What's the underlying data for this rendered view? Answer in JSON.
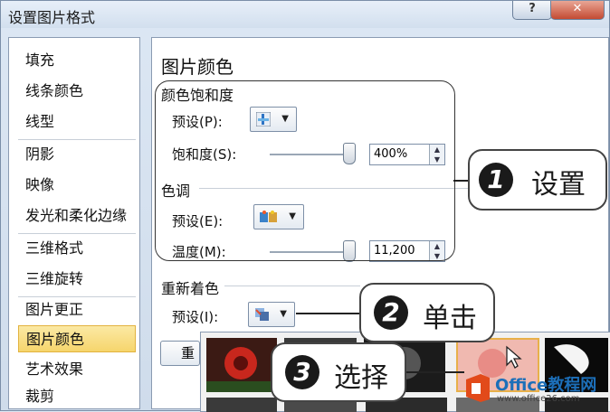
{
  "window": {
    "title": "设置图片格式",
    "help_label": "?",
    "close_label": "✕"
  },
  "nav": {
    "items": [
      {
        "label": "填充"
      },
      {
        "label": "线条颜色"
      },
      {
        "label": "线型"
      },
      {
        "label": "阴影"
      },
      {
        "label": "映像"
      },
      {
        "label": "发光和柔化边缘"
      },
      {
        "label": "三维格式"
      },
      {
        "label": "三维旋转"
      },
      {
        "label": "图片更正"
      },
      {
        "label": "图片颜色"
      },
      {
        "label": "艺术效果"
      },
      {
        "label": "裁剪"
      }
    ],
    "active_label": "图片颜色"
  },
  "panel": {
    "title": "图片颜色",
    "saturation": {
      "group_title": "颜色饱和度",
      "preset_label": "预设(P):",
      "value_label": "饱和度(S):",
      "value": "400%",
      "slider_fraction": 1.0
    },
    "tone": {
      "group_title": "色调",
      "preset_label": "预设(E):",
      "value_label": "温度(M):",
      "value": "11,200",
      "slider_fraction": 1.0
    },
    "recolor": {
      "group_title": "重新着色",
      "preset_label": "预设(I):"
    },
    "reset_label": "重"
  },
  "callouts": [
    {
      "number": "1",
      "text": "设置"
    },
    {
      "number": "2",
      "text": "单击"
    },
    {
      "number": "3",
      "text": "选择"
    }
  ],
  "watermark": {
    "brand": "Office教程网",
    "url": "www.office26.com"
  },
  "colors": {
    "accent_active": "#f6d56c",
    "close": "#c44b33"
  }
}
